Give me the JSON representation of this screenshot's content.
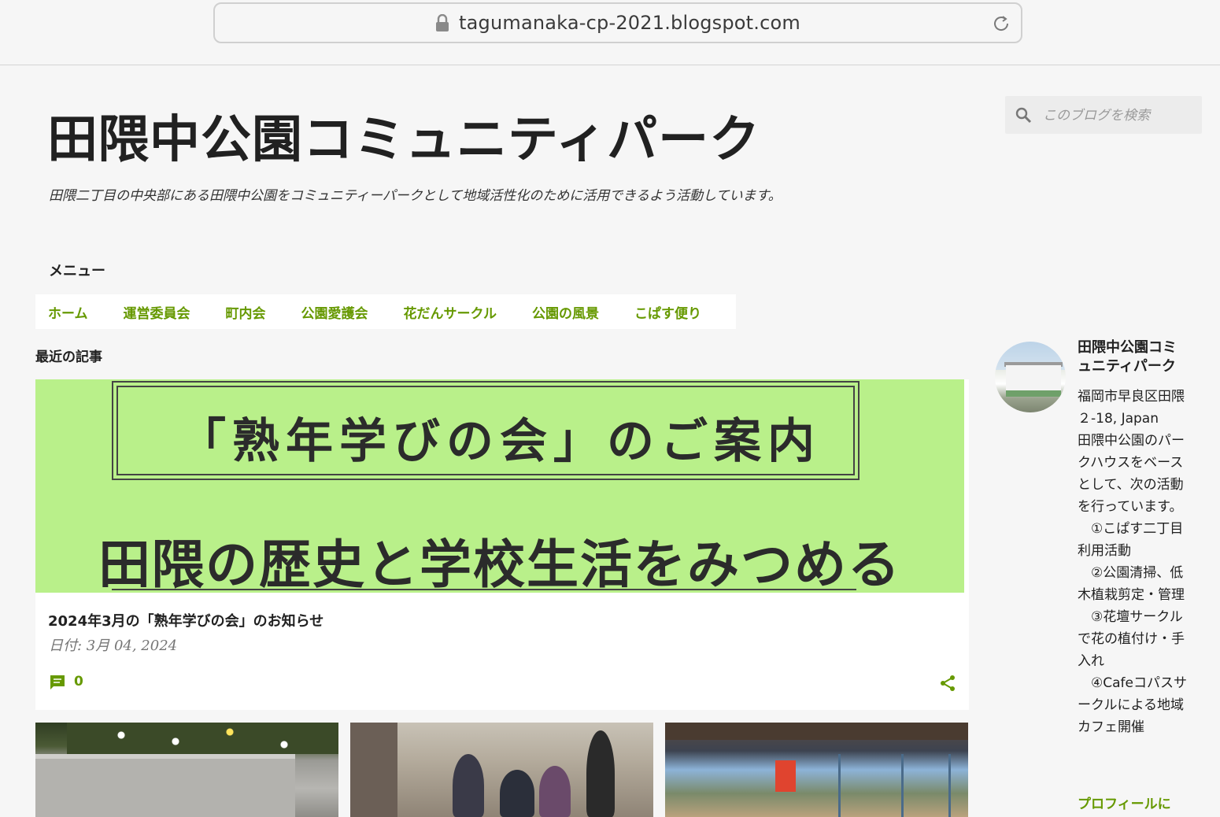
{
  "browser": {
    "url": "tagumanaka-cp-2021.blogspot.com"
  },
  "header": {
    "title": "田隈中公園コミュニティパーク",
    "description": "田隈二丁目の中央部にある田隈中公園をコミュニティーパークとして地域活性化のために活用できるよう活動しています。"
  },
  "search": {
    "placeholder": "このブログを検索"
  },
  "menu": {
    "heading": "メニュー",
    "items": [
      {
        "label": "ホーム"
      },
      {
        "label": "運営委員会"
      },
      {
        "label": "町内会"
      },
      {
        "label": "公園愛護会"
      },
      {
        "label": "花だんサークル"
      },
      {
        "label": "公園の風景"
      },
      {
        "label": "こぱす便り"
      }
    ]
  },
  "recent": {
    "heading": "最近の記事",
    "featured": {
      "image_line1": "「熟年学びの会」のご案内",
      "image_line2": "田隈の歴史と学校生活をみつめる",
      "title": "2024年3月の「熟年学びの会」のお知らせ",
      "date": "日付: 3月 04, 2024",
      "comment_count": "0"
    }
  },
  "profile": {
    "name": "田隈中公園コミュニティパーク",
    "text": "福岡市早良区田隈２-18, Japan\n田隈中公園のパークハウスをベースとして、次の活動を行っています。\n　①こぱす二丁目利用活動\n　②公園清掃、低木植栽剪定・管理\n　③花壇サークルで花の植付け・手入れ\n　④Cafeコパスサークルによる地域カフェ開催",
    "link": "プロフィールに"
  },
  "colors": {
    "accent": "#669900",
    "background": "#f6f6f6",
    "featured_image_bg": "#b9f08a"
  }
}
